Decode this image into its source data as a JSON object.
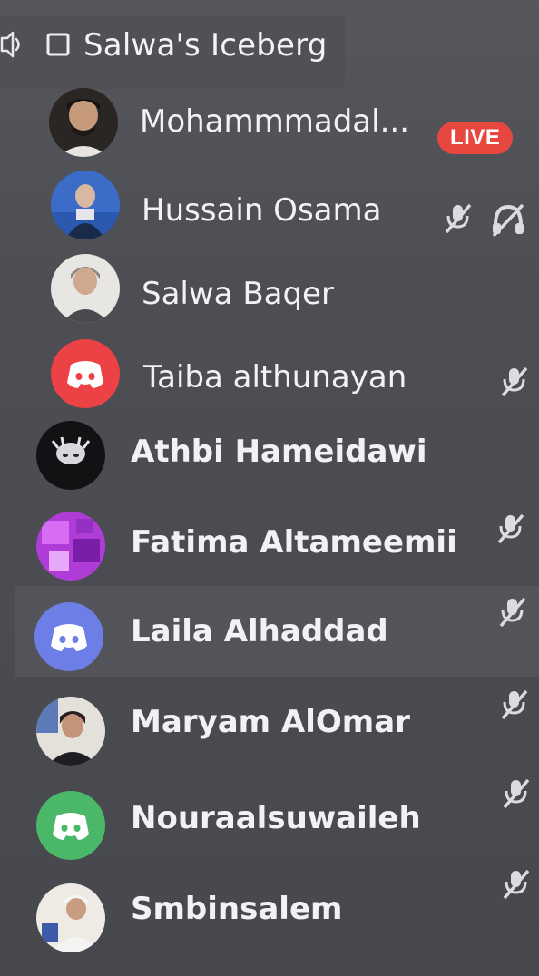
{
  "channel": {
    "name": "Salwa's Iceberg",
    "icon": "stage-channel-icon"
  },
  "live_label": "LIVE",
  "users": [
    {
      "name": "Mohammmadal...",
      "avatar": "photo",
      "live": true,
      "muted": false,
      "deafened": false
    },
    {
      "name": "Hussain Osama",
      "avatar": "photo",
      "live": false,
      "muted": true,
      "deafened": true
    },
    {
      "name": "Salwa Baqer",
      "avatar": "photo",
      "live": false,
      "muted": false,
      "deafened": false
    },
    {
      "name": "Taiba althunayan",
      "avatar": "discord-red",
      "live": false,
      "muted": true,
      "deafened": false
    },
    {
      "name": "Athbi Hameidawi",
      "avatar": "photo-dark",
      "live": false,
      "muted": false,
      "deafened": false
    },
    {
      "name": "Fatima Altameemii",
      "avatar": "photo-purple",
      "live": false,
      "muted": true,
      "deafened": false
    },
    {
      "name": "Laila Alhaddad",
      "avatar": "discord-blurple",
      "live": false,
      "muted": true,
      "deafened": false
    },
    {
      "name": "Maryam AlOmar",
      "avatar": "photo",
      "live": false,
      "muted": true,
      "deafened": false
    },
    {
      "name": "Nouraalsuwaileh",
      "avatar": "discord-green",
      "live": false,
      "muted": true,
      "deafened": false
    },
    {
      "name": "Smbinsalem",
      "avatar": "photo-light",
      "live": false,
      "muted": true,
      "deafened": false
    }
  ],
  "colors": {
    "live": "#e8473f",
    "discord_red": "#ed4245",
    "discord_blurple": "#5865f2",
    "discord_green": "#3ba55c",
    "background": "#4a4c52"
  }
}
